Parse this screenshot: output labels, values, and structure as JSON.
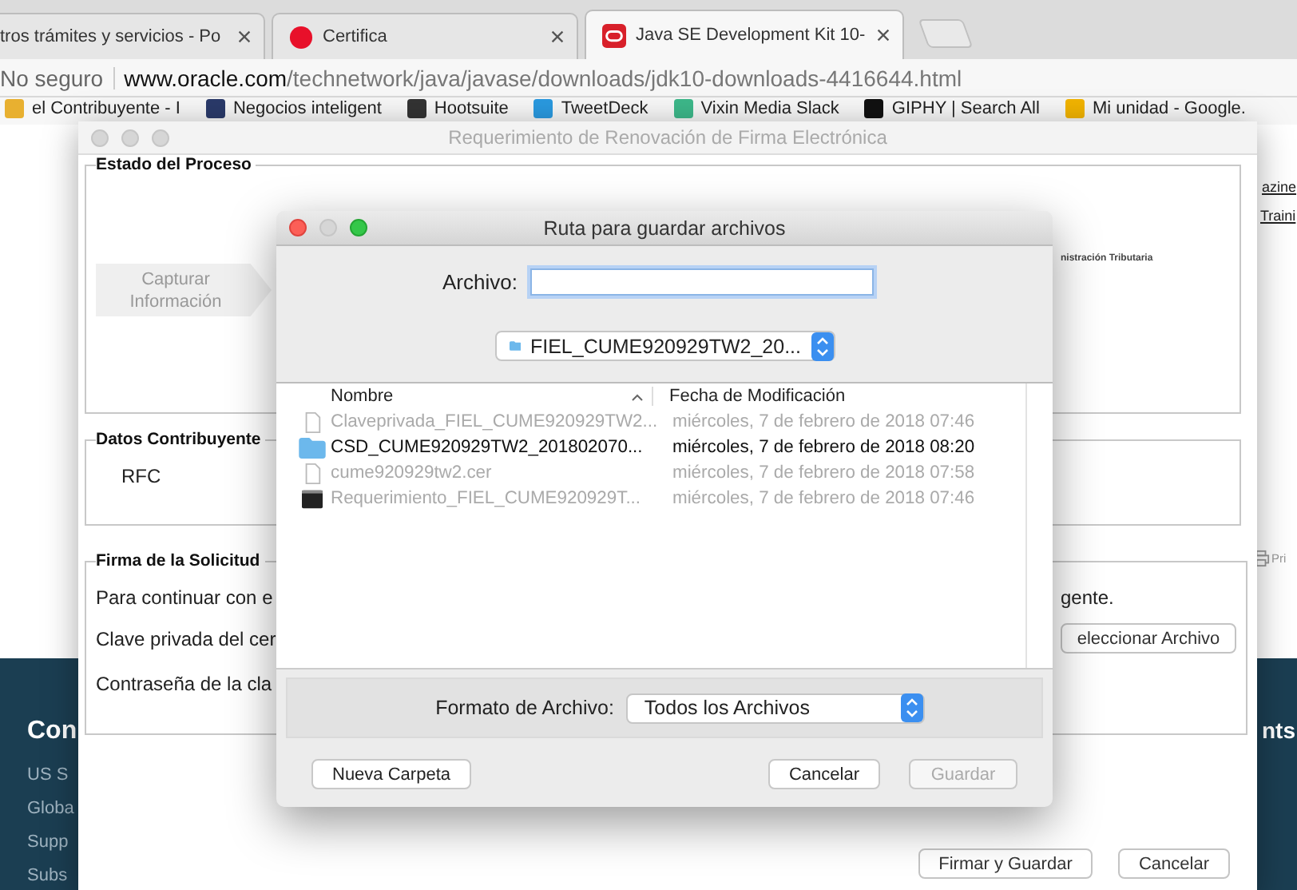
{
  "browser": {
    "tabs": [
      {
        "title": "tros trámites y servicios - Po",
        "kind": "plain",
        "selected": false
      },
      {
        "title": "Certifica",
        "kind": "record",
        "selected": false
      },
      {
        "title": "Java SE Development Kit 10-",
        "kind": "oracle",
        "selected": true
      }
    ],
    "address": {
      "security": "No seguro",
      "host": "www.oracle.com",
      "path": "/technetwork/java/javase/downloads/jdk10-downloads-4416644.html"
    },
    "bookmarks": [
      {
        "label": "el Contribuyente - I",
        "color": "#e8b030"
      },
      {
        "label": "Negocios inteligent",
        "color": "#2a3a6a"
      },
      {
        "label": "Hootsuite",
        "color": "#333333"
      },
      {
        "label": "TweetDeck",
        "color": "#2a9ae0"
      },
      {
        "label": "Vixin Media Slack",
        "color": "#3db88a"
      },
      {
        "label": "GIPHY | Search All",
        "color": "#111111"
      },
      {
        "label": "Mi unidad - Google.",
        "color": "#f2b400"
      }
    ]
  },
  "page": {
    "links": [
      "azine",
      "Traini"
    ],
    "print_link": "Pri",
    "footer": {
      "heading": "Con",
      "heading_right": "nts",
      "links": [
        "US S",
        "Globa",
        "Supp",
        "Subs"
      ]
    }
  },
  "app_window": {
    "title": "Requerimiento de Renovación de Firma Electrónica",
    "process": {
      "title": "Estado del Proceso",
      "logo_text": "nistración Tributaria",
      "steps": [
        "Capturar Información"
      ]
    },
    "taxpayer": {
      "title": "Datos Contribuyente",
      "rfc_label": "RFC"
    },
    "signature": {
      "title": "Firma de la Solicitud",
      "intro": "Para continuar con e",
      "intro_end": "gente.",
      "key_label": "Clave privada del cer",
      "select_button": "eleccionar Archivo",
      "password_label": "Contraseña de la cla"
    },
    "buttons": [
      "Firmar y Guardar",
      "Cancelar"
    ]
  },
  "dialog": {
    "title": "Ruta para guardar archivos",
    "file_label": "Archivo:",
    "folder": "FIEL_CUME920929TW2_20...",
    "columns": [
      "Nombre",
      "Fecha de Modificación"
    ],
    "files": [
      {
        "name": "Claveprivada_FIEL_CUME920929TW2...",
        "date": "miércoles, 7 de febrero de 2018 07:46",
        "kind": "file",
        "disabled": true
      },
      {
        "name": "CSD_CUME920929TW2_201802070...",
        "date": "miércoles, 7 de febrero de 2018 08:20",
        "kind": "folder",
        "disabled": false
      },
      {
        "name": "cume920929tw2.cer",
        "date": "miércoles, 7 de febrero de 2018 07:58",
        "kind": "file",
        "disabled": true
      },
      {
        "name": "Requerimiento_FIEL_CUME920929T...",
        "date": "miércoles, 7 de febrero de 2018 07:46",
        "kind": "exec",
        "disabled": true
      }
    ],
    "format_label": "Formato de Archivo:",
    "format": "Todos los Archivos",
    "new_folder": "Nueva Carpeta",
    "cancel": "Cancelar",
    "save": {
      "label": "Guardar",
      "disabled": true
    }
  }
}
